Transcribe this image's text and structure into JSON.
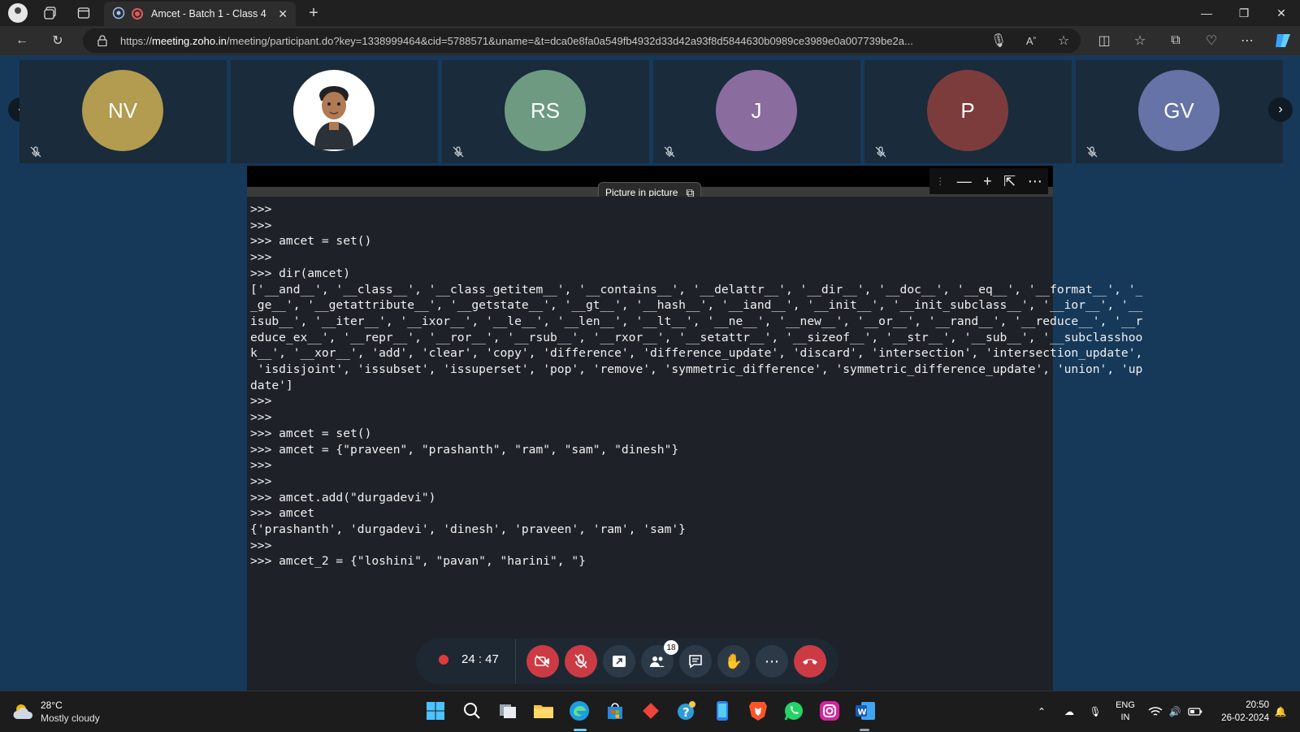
{
  "browser": {
    "tab_title": "Amcet - Batch 1 - Class 4",
    "url_prefix": "https://",
    "url_host": "meeting.zoho.in",
    "url_rest": "/meeting/participant.do?key=1338999464&cid=5788571&uname=&t=dca0e8fa0a549fb4932d33d42a93f8d5844630b0989ce3989e0a007739be2a..."
  },
  "participants": [
    {
      "initials": "NV",
      "color": "#b39b4f"
    },
    {
      "initials": "",
      "color": "#ffffff"
    },
    {
      "initials": "RS",
      "color": "#6e9a82"
    },
    {
      "initials": "J",
      "color": "#8a6c9e"
    },
    {
      "initials": "P",
      "color": "#7d3c3c"
    },
    {
      "initials": "GV",
      "color": "#6673a6"
    }
  ],
  "screen_share": {
    "pip_tooltip": "Picture in picture"
  },
  "terminal_lines": [
    ">>>",
    ">>>",
    ">>> amcet = set()",
    ">>>",
    ">>> dir(amcet)",
    "['__and__', '__class__', '__class_getitem__', '__contains__', '__delattr__', '__dir__', '__doc__', '__eq__', '__format__', '_",
    "_ge__', '__getattribute__', '__getstate__', '__gt__', '__hash__', '__iand__', '__init__', '__init_subclass__', '__ior__', '__",
    "isub__', '__iter__', '__ixor__', '__le__', '__len__', '__lt__', '__ne__', '__new__', '__or__', '__rand__', '__reduce__', '__r",
    "educe_ex__', '__repr__', '__ror__', '__rsub__', '__rxor__', '__setattr__', '__sizeof__', '__str__', '__sub__', '__subclasshoo",
    "k__', '__xor__', 'add', 'clear', 'copy', 'difference', 'difference_update', 'discard', 'intersection', 'intersection_update',",
    " 'isdisjoint', 'issubset', 'issuperset', 'pop', 'remove', 'symmetric_difference', 'symmetric_difference_update', 'union', 'up",
    "date']",
    ">>>",
    ">>>",
    ">>> amcet = set()",
    ">>> amcet = {\"praveen\", \"prashanth\", \"ram\", \"sam\", \"dinesh\"}",
    ">>>",
    ">>>",
    ">>> amcet.add(\"durgadevi\")",
    ">>> amcet",
    "{'prashanth', 'durgadevi', 'dinesh', 'praveen', 'ram', 'sam'}",
    ">>>",
    ">>> amcet_2 = {\"loshini\", \"pavan\", \"harini\", \"}"
  ],
  "controls": {
    "timer": "24 : 47",
    "participants_count": "18"
  },
  "taskbar": {
    "temperature": "28°C",
    "condition": "Mostly cloudy",
    "lang_top": "ENG",
    "lang_bottom": "IN",
    "time": "20:50",
    "date": "26-02-2024"
  }
}
